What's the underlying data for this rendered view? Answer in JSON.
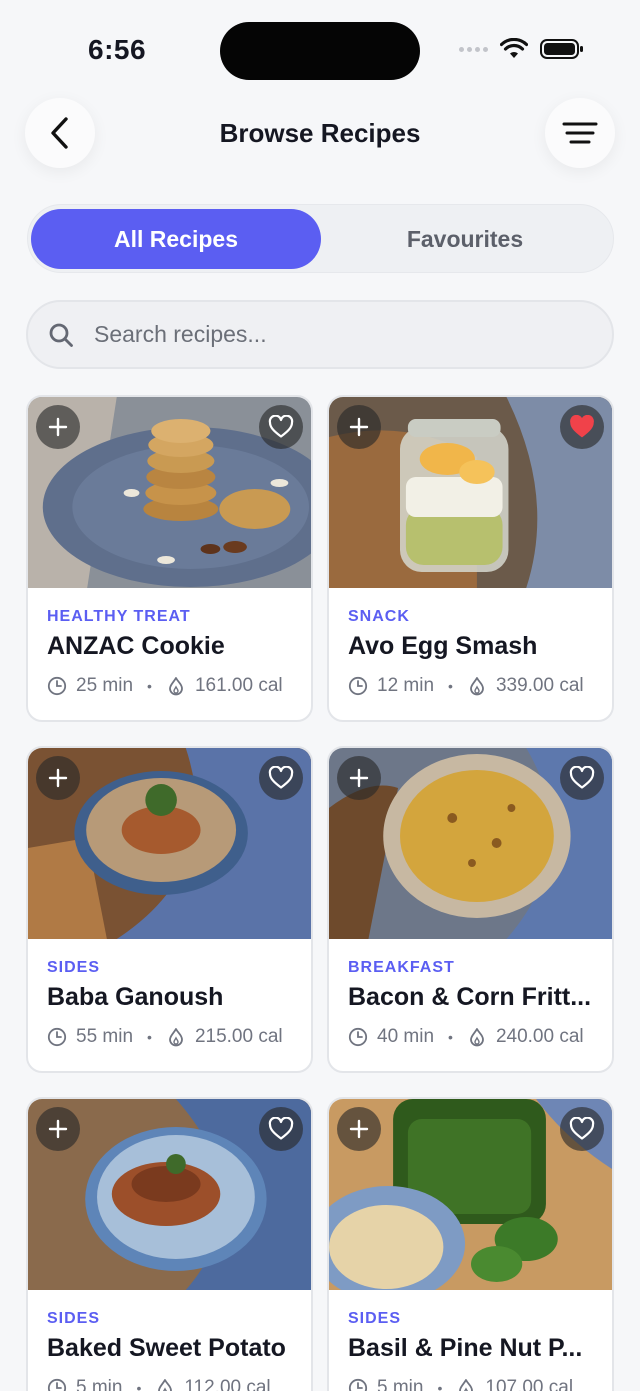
{
  "status_bar": {
    "time": "6:56"
  },
  "header": {
    "title": "Browse Recipes",
    "back_icon": "chevron-left-icon",
    "filter_icon": "menu-lines-icon"
  },
  "tabs": [
    {
      "label": "All Recipes",
      "active": true
    },
    {
      "label": "Favourites",
      "active": false
    }
  ],
  "search": {
    "placeholder": "Search recipes...",
    "value": ""
  },
  "recipes": [
    {
      "category": "HEALTHY TREAT",
      "name": "ANZAC Cookie",
      "time": "25 min",
      "calories": "161.00 cal",
      "favourite": false
    },
    {
      "category": "SNACK",
      "name": "Avo Egg Smash",
      "time": "12 min",
      "calories": "339.00 cal",
      "favourite": true
    },
    {
      "category": "SIDES",
      "name": "Baba Ganoush",
      "time": "55 min",
      "calories": "215.00 cal",
      "favourite": false
    },
    {
      "category": "BREAKFAST",
      "name": "Bacon & Corn Fritt...",
      "time": "40 min",
      "calories": "240.00 cal",
      "favourite": false
    },
    {
      "category": "SIDES",
      "name": "Baked Sweet Potato",
      "time": "5 min",
      "calories": "112.00 cal",
      "favourite": false
    },
    {
      "category": "SIDES",
      "name": "Basil & Pine Nut P...",
      "time": "5 min",
      "calories": "107.00 cal",
      "favourite": false
    }
  ],
  "colors": {
    "accent": "#5b5ef2",
    "favourite": "#f0424a",
    "background": "#f6f7f9"
  }
}
